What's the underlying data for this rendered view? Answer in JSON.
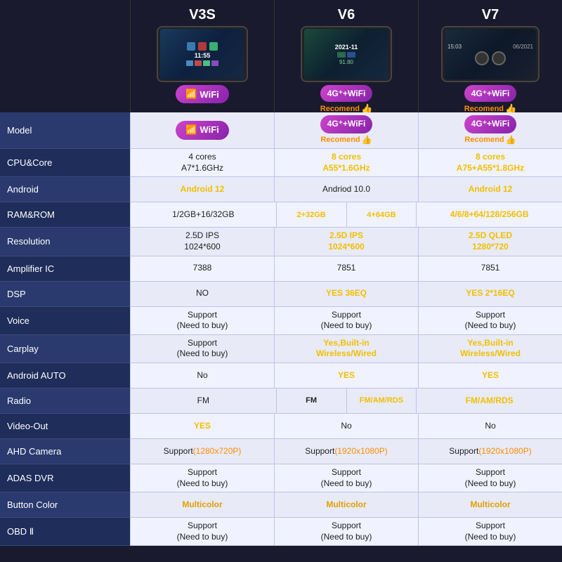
{
  "products": [
    {
      "id": "v3s",
      "title": "V3S",
      "badge_type": "wifi",
      "badge_label": "WiFi",
      "has_recomend": false
    },
    {
      "id": "v6",
      "title": "V6",
      "badge_type": "4g_wifi",
      "badge_label": "4G⁺+WiFi",
      "has_recomend": true
    },
    {
      "id": "v7",
      "title": "V7",
      "badge_type": "4g_wifi",
      "badge_label": "4G⁺+WiFi",
      "has_recomend": true
    }
  ],
  "rows": [
    {
      "label": "Model",
      "cells": [
        {
          "type": "badge_wifi",
          "text": "WiFi"
        },
        {
          "type": "badge_4g",
          "text": "4G⁺+WiFi",
          "recomend": true
        },
        {
          "type": "badge_4g",
          "text": "4G⁺+WiFi",
          "recomend": true
        }
      ]
    },
    {
      "label": "CPU&Core",
      "cells": [
        {
          "type": "normal",
          "text": "4 cores\nA7*1.6GHz"
        },
        {
          "type": "yellow",
          "text": "8 cores\nA55*1.6GHz"
        },
        {
          "type": "yellow",
          "text": "8 cores\nA75+A55*1.8GHz"
        }
      ]
    },
    {
      "label": "Android",
      "cells": [
        {
          "type": "yellow",
          "text": "Android 12"
        },
        {
          "type": "normal",
          "text": "Andriod 10.0"
        },
        {
          "type": "yellow",
          "text": "Android 12"
        }
      ]
    },
    {
      "label": "RAM&ROM",
      "cells": [
        {
          "type": "normal",
          "text": "1/2GB+16/32GB"
        },
        {
          "type": "sub2",
          "sub": [
            {
              "text": "2+32GB",
              "color": "yellow"
            },
            {
              "text": "4+64GB",
              "color": "yellow"
            }
          ]
        },
        {
          "type": "yellow",
          "text": "4/6/8+64/128/256GB"
        }
      ]
    },
    {
      "label": "Resolution",
      "cells": [
        {
          "type": "normal",
          "text": "2.5D IPS\n1024*600"
        },
        {
          "type": "yellow",
          "text": "2.5D IPS\n1024*600"
        },
        {
          "type": "yellow",
          "text": "2.5D QLED\n1280*720"
        }
      ]
    },
    {
      "label": "Amplifier IC",
      "cells": [
        {
          "type": "normal",
          "text": "7388"
        },
        {
          "type": "normal",
          "text": "7851"
        },
        {
          "type": "normal",
          "text": "7851"
        }
      ]
    },
    {
      "label": "DSP",
      "cells": [
        {
          "type": "normal",
          "text": "NO"
        },
        {
          "type": "yellow",
          "text": "YES 36EQ"
        },
        {
          "type": "yellow",
          "text": "YES 2*16EQ"
        }
      ]
    },
    {
      "label": "Voice",
      "cells": [
        {
          "type": "normal",
          "text": "Support\n(Need to buy)"
        },
        {
          "type": "normal",
          "text": "Support\n(Need to buy)"
        },
        {
          "type": "normal",
          "text": "Support\n(Need to buy)"
        }
      ]
    },
    {
      "label": "Carplay",
      "cells": [
        {
          "type": "normal",
          "text": "Support\n(Need to buy)"
        },
        {
          "type": "yellow",
          "text": "Yes,Built-in\nWireless/Wired"
        },
        {
          "type": "yellow",
          "text": "Yes,Built-in\nWireless/Wired"
        }
      ]
    },
    {
      "label": "Android AUTO",
      "cells": [
        {
          "type": "normal",
          "text": "No"
        },
        {
          "type": "yellow",
          "text": "YES"
        },
        {
          "type": "yellow",
          "text": "YES"
        }
      ]
    },
    {
      "label": "Radio",
      "cells": [
        {
          "type": "normal",
          "text": "FM"
        },
        {
          "type": "sub2",
          "sub": [
            {
              "text": "FM",
              "color": "normal"
            },
            {
              "text": "FM/AM/RDS",
              "color": "yellow"
            }
          ]
        },
        {
          "type": "yellow",
          "text": "FM/AM/RDS"
        }
      ]
    },
    {
      "label": "Video-Out",
      "cells": [
        {
          "type": "yellow",
          "text": "YES"
        },
        {
          "type": "normal",
          "text": "No"
        },
        {
          "type": "normal",
          "text": "No"
        }
      ]
    },
    {
      "label": "AHD Camera",
      "cells": [
        {
          "type": "normal_orange",
          "text": "Support\n(1280x720P)"
        },
        {
          "type": "normal_orange",
          "text": "Support\n(1920x1080P)"
        },
        {
          "type": "normal_orange",
          "text": "Support\n(1920x1080P)"
        }
      ]
    },
    {
      "label": "ADAS DVR",
      "cells": [
        {
          "type": "normal",
          "text": "Support\n(Need to buy)"
        },
        {
          "type": "normal",
          "text": "Support\n(Need to buy)"
        },
        {
          "type": "normal",
          "text": "Support\n(Need to buy)"
        }
      ]
    },
    {
      "label": "Button Color",
      "cells": [
        {
          "type": "multicolor",
          "text": "Multicolor"
        },
        {
          "type": "multicolor",
          "text": "Multicolor"
        },
        {
          "type": "multicolor",
          "text": "Multicolor"
        }
      ]
    },
    {
      "label": "OBD Ⅱ",
      "cells": [
        {
          "type": "normal",
          "text": "Support\n(Need to buy)"
        },
        {
          "type": "normal",
          "text": "Support\n(Need to buy)"
        },
        {
          "type": "normal",
          "text": "Support\n(Need to buy)"
        }
      ]
    }
  ]
}
